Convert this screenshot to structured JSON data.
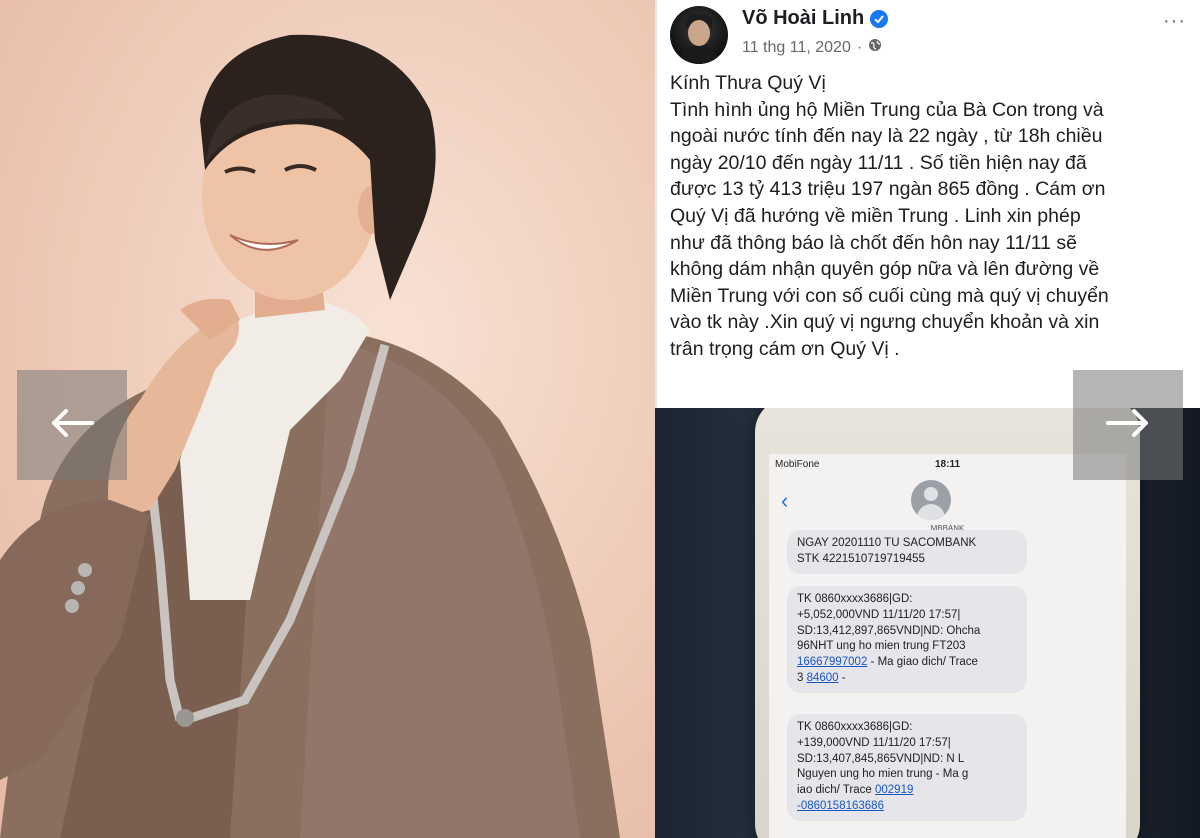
{
  "post": {
    "author": "Võ Hoài Linh",
    "date": "11 thg 11, 2020",
    "separator": "·",
    "more": "···",
    "greeting": "Kính Thưa Quý Vị",
    "body": "Tình hình ủng hộ Miền Trung của Bà Con trong và\nngoài nước tính đến nay là 22 ngày , từ 18h chiều\nngày 20/10 đến ngày 11/11 . Số tiền hiện nay đã\nđược 13 tỷ 413 triệu 197 ngàn 865 đồng . Cám ơn\nQuý Vị  đã hướng về miền Trung . Linh xin phép\nnhư đã thông báo là chốt đến hôn nay  11/11 sẽ\nkhông  dám nhận quyên góp nữa và lên đường về\nMiền Trung với con số cuối cùng mà quý vị chuyển\nvào tk này .Xin quý vị  ngưng chuyển khoản và xin\ntrân trọng cám ơn Quý Vị ."
  },
  "phone": {
    "carrier": "MobiFone",
    "time": "18:11",
    "sender": "MBBANK",
    "messages": [
      {
        "text": "NGAY 20201110 TU SACOMBANK\nSTK 4221510719719455"
      },
      {
        "text": "TK 0860xxxx3686|GD:\n+5,052,000VND 11/11/20 17:57|\nSD:13,412,897,865VND|ND: Ohcha\n96NHT ung ho mien trung FT203\n",
        "link1": "16667997002",
        "tail1": " - Ma giao dich/ Trace\n3 ",
        "link2": "84600",
        "tail2": " -"
      },
      {
        "text": "TK 0860xxxx3686|GD:\n+139,000VND 11/11/20 17:57|\nSD:13,407,845,865VND|ND: N L\nNguyen ung ho mien trung - Ma g\niao dich/ Trace ",
        "link1": "002919",
        "tail1": "\n",
        "link2": "-0860158163686",
        "tail2": ""
      }
    ]
  },
  "gallery": {
    "prev_icon": "arrow-left-icon",
    "next_icon": "arrow-right-icon"
  },
  "colors": {
    "verified": "#1877f2",
    "text": "#1c1e21",
    "meta": "#65676b",
    "link": "#1a56c8"
  }
}
